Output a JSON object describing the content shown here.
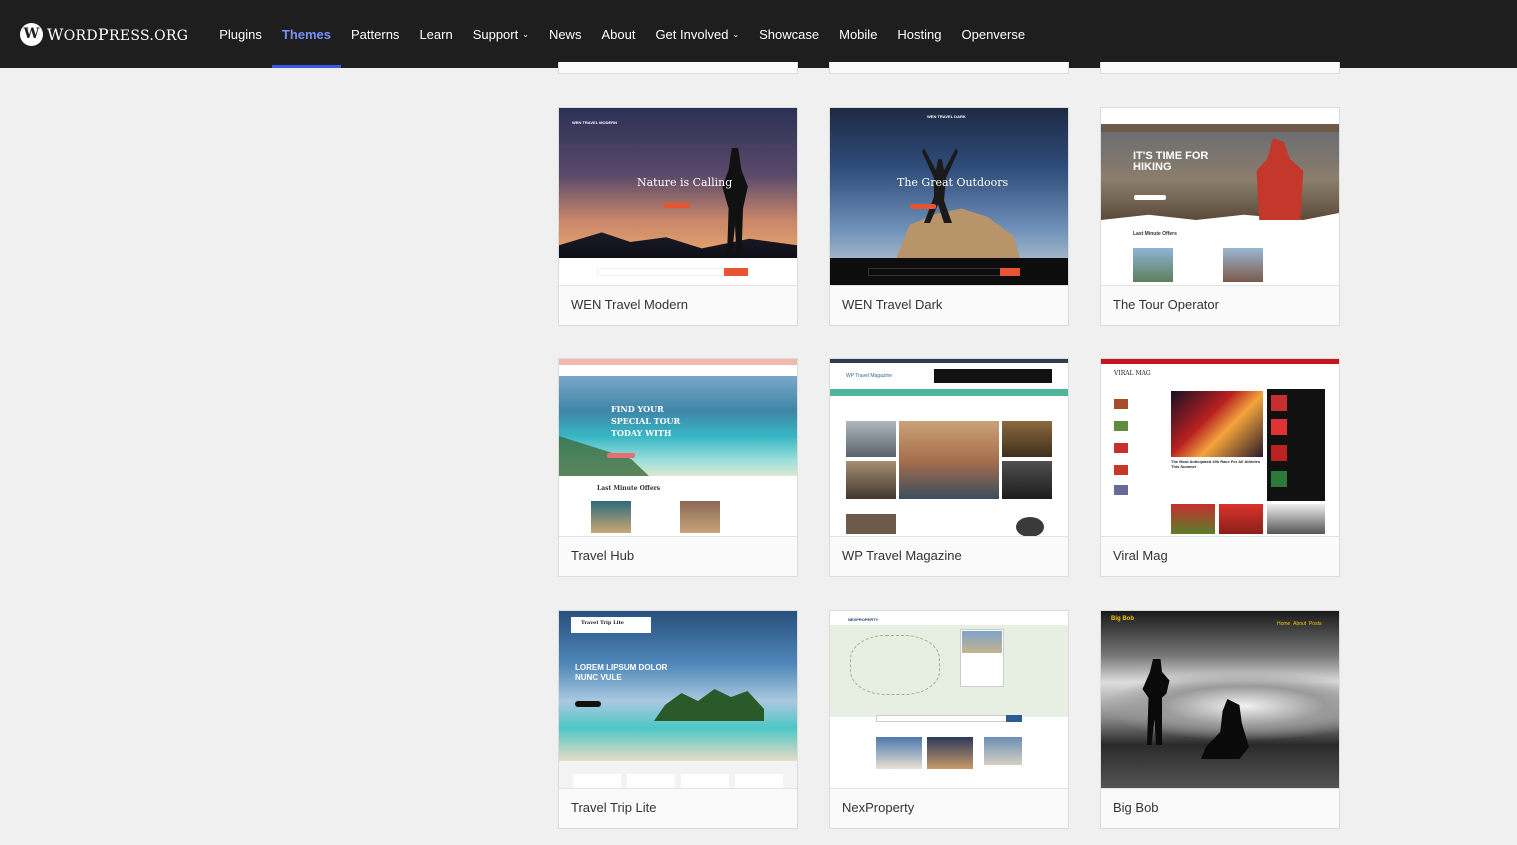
{
  "header": {
    "brand": "WordPress.org",
    "nav": [
      {
        "label": "Plugins"
      },
      {
        "label": "Themes",
        "active": true
      },
      {
        "label": "Patterns"
      },
      {
        "label": "Learn"
      },
      {
        "label": "Support",
        "dropdown": true
      },
      {
        "label": "News"
      },
      {
        "label": "About"
      },
      {
        "label": "Get Involved",
        "dropdown": true
      },
      {
        "label": "Showcase"
      },
      {
        "label": "Mobile"
      },
      {
        "label": "Hosting"
      },
      {
        "label": "Openverse"
      }
    ]
  },
  "themes": [
    {
      "name": "WEN Travel Modern",
      "preview_text": "Nature is Calling"
    },
    {
      "name": "WEN Travel Dark",
      "preview_text": "The Great Outdoors"
    },
    {
      "name": "The Tour Operator",
      "preview_text": "IT'S TIME FOR HIKING",
      "preview_sub": "Last Minute Offers"
    },
    {
      "name": "Travel Hub",
      "preview_text": "FIND YOUR SPECIAL TOUR TODAY WITH",
      "preview_sub": "Last Minute Offers"
    },
    {
      "name": "WP Travel Magazine",
      "preview_text": "WP Travel Magazine"
    },
    {
      "name": "Viral Mag",
      "preview_text": "VIRAL MAG",
      "preview_sub": "The Most Anticipated 40k Race For All Athletes This Summer"
    },
    {
      "name": "Travel Trip Lite",
      "preview_text": "LOREM LIPSUM DOLOR NUNC VULE"
    },
    {
      "name": "NexProperty",
      "preview_text": "NEXPROPERTY"
    },
    {
      "name": "Big Bob",
      "preview_text": "Big Bob"
    }
  ]
}
